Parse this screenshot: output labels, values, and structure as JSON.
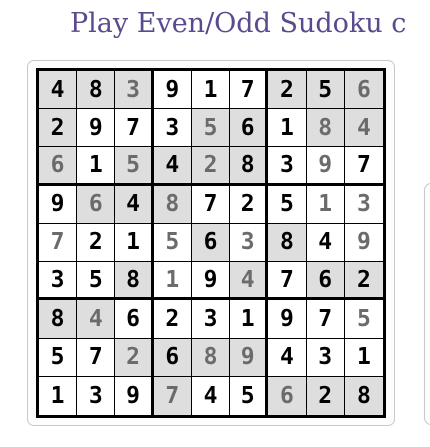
{
  "title": "Play Even/Odd Sudoku c",
  "puzzle": {
    "rows": [
      [
        4,
        8,
        3,
        9,
        1,
        7,
        2,
        5,
        6
      ],
      [
        2,
        9,
        7,
        3,
        5,
        6,
        1,
        8,
        4
      ],
      [
        6,
        1,
        5,
        4,
        2,
        8,
        3,
        9,
        7
      ],
      [
        9,
        6,
        4,
        8,
        7,
        2,
        5,
        1,
        3
      ],
      [
        7,
        2,
        1,
        5,
        6,
        3,
        8,
        4,
        9
      ],
      [
        3,
        5,
        8,
        1,
        9,
        4,
        7,
        6,
        2
      ],
      [
        8,
        4,
        6,
        2,
        3,
        1,
        9,
        7,
        5
      ],
      [
        5,
        7,
        2,
        6,
        8,
        9,
        4,
        3,
        1
      ],
      [
        1,
        3,
        9,
        7,
        4,
        5,
        6,
        2,
        8
      ]
    ],
    "given": [
      [
        1,
        1,
        0,
        1,
        1,
        1,
        1,
        1,
        0
      ],
      [
        1,
        1,
        1,
        1,
        0,
        1,
        1,
        0,
        0
      ],
      [
        0,
        1,
        0,
        1,
        0,
        1,
        1,
        0,
        1
      ],
      [
        1,
        0,
        1,
        0,
        1,
        1,
        1,
        0,
        0
      ],
      [
        0,
        1,
        1,
        0,
        1,
        0,
        1,
        1,
        0
      ],
      [
        1,
        1,
        1,
        0,
        1,
        0,
        1,
        1,
        1
      ],
      [
        1,
        0,
        1,
        1,
        1,
        1,
        1,
        1,
        0
      ],
      [
        1,
        1,
        0,
        1,
        0,
        0,
        1,
        1,
        1
      ],
      [
        1,
        1,
        1,
        0,
        1,
        1,
        0,
        1,
        1
      ]
    ],
    "shaded": [
      [
        1,
        1,
        1,
        0,
        0,
        0,
        1,
        1,
        1
      ],
      [
        1,
        0,
        0,
        0,
        1,
        1,
        0,
        1,
        1
      ],
      [
        1,
        0,
        1,
        1,
        1,
        1,
        0,
        0,
        0
      ],
      [
        0,
        1,
        1,
        1,
        0,
        0,
        0,
        0,
        0
      ],
      [
        0,
        0,
        0,
        0,
        1,
        0,
        1,
        0,
        0
      ],
      [
        0,
        0,
        1,
        0,
        0,
        1,
        0,
        1,
        1
      ],
      [
        1,
        1,
        0,
        0,
        0,
        0,
        0,
        0,
        0
      ],
      [
        0,
        0,
        1,
        1,
        1,
        1,
        0,
        0,
        0
      ],
      [
        0,
        0,
        0,
        1,
        0,
        0,
        1,
        1,
        1
      ]
    ]
  },
  "colors": {
    "title": "#5a4a8e",
    "shade": "#dedede",
    "given": "#000000",
    "entered": "#6b6b6b"
  }
}
